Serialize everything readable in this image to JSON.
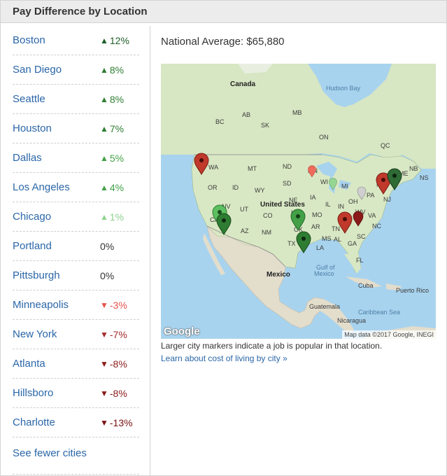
{
  "header": {
    "title": "Pay Difference by Location"
  },
  "cities": [
    {
      "name": "Boston",
      "direction": "up",
      "change": "12%",
      "color": "#1e5e28"
    },
    {
      "name": "San Diego",
      "direction": "up",
      "change": "8%",
      "color": "#2f7d32"
    },
    {
      "name": "Seattle",
      "direction": "up",
      "change": "8%",
      "color": "#2f7d32"
    },
    {
      "name": "Houston",
      "direction": "up",
      "change": "7%",
      "color": "#2f7d32"
    },
    {
      "name": "Dallas",
      "direction": "up",
      "change": "5%",
      "color": "#43a047"
    },
    {
      "name": "Los Angeles",
      "direction": "up",
      "change": "4%",
      "color": "#43a047"
    },
    {
      "name": "Chicago",
      "direction": "up",
      "change": "1%",
      "color": "#8ed08e"
    },
    {
      "name": "Portland",
      "direction": "none",
      "change": "0%",
      "color": "#333333"
    },
    {
      "name": "Pittsburgh",
      "direction": "none",
      "change": "0%",
      "color": "#333333"
    },
    {
      "name": "Minneapolis",
      "direction": "down",
      "change": "-3%",
      "color": "#e5534b"
    },
    {
      "name": "New York",
      "direction": "down",
      "change": "-7%",
      "color": "#a52a2a"
    },
    {
      "name": "Atlanta",
      "direction": "down",
      "change": "-8%",
      "color": "#8b1a1a"
    },
    {
      "name": "Hillsboro",
      "direction": "down",
      "change": "-8%",
      "color": "#8b1a1a"
    },
    {
      "name": "Charlotte",
      "direction": "down",
      "change": "-13%",
      "color": "#7a1010"
    }
  ],
  "see_fewer_label": "See fewer cities",
  "national_average": "National Average: $65,880",
  "map": {
    "labels": {
      "canada": "Canada",
      "hudson_bay": "Hudson Bay",
      "united_states": "United States",
      "mexico": "Mexico",
      "gulf": "Gulf of",
      "gulf2": "Mexico",
      "cuba": "Cuba",
      "puerto_rico": "Puerto Rico",
      "guatemala": "Guatemala",
      "caribbean": "Caribbean Sea",
      "nicaragua": "Nicaragua",
      "bc": "BC",
      "ab": "AB",
      "sk": "SK",
      "mb": "MB",
      "on": "ON",
      "qc": "QC",
      "nb": "NB",
      "ns": "NS",
      "wa": "WA",
      "mt": "MT",
      "nd": "ND",
      "mn": "MN",
      "or": "OR",
      "id": "ID",
      "wy": "WY",
      "sd": "SD",
      "wi": "WI",
      "mi": "MI",
      "nv": "NV",
      "ut": "UT",
      "co": "CO",
      "ne": "NE",
      "ia": "IA",
      "il": "IL",
      "in": "IN",
      "oh": "OH",
      "pa": "PA",
      "ny": "NY",
      "me": "ME",
      "ca": "CA",
      "az": "AZ",
      "nm": "NM",
      "ks": "KS",
      "mo": "MO",
      "ky": "KY",
      "wv": "WV",
      "va": "VA",
      "ok": "OK",
      "tn": "TN",
      "nc": "NC",
      "ar": "AR",
      "sc": "SC",
      "ms": "MS",
      "al": "AL",
      "ga": "GA",
      "tx": "TX",
      "la": "LA",
      "fl": "FL",
      "nj": "NJ"
    },
    "google": "Google",
    "attribution": "Map data ©2017 Google, INEGI"
  },
  "map_caption": "Larger city markers indicate a job is popular in that location.",
  "map_link": "Learn about cost of living by city »",
  "colors": {
    "link": "#2a66a8",
    "up_dark": "#1e5e28",
    "down_dark": "#8b1a1a",
    "water": "#a8d3ee",
    "land": "#d9e8c4"
  }
}
